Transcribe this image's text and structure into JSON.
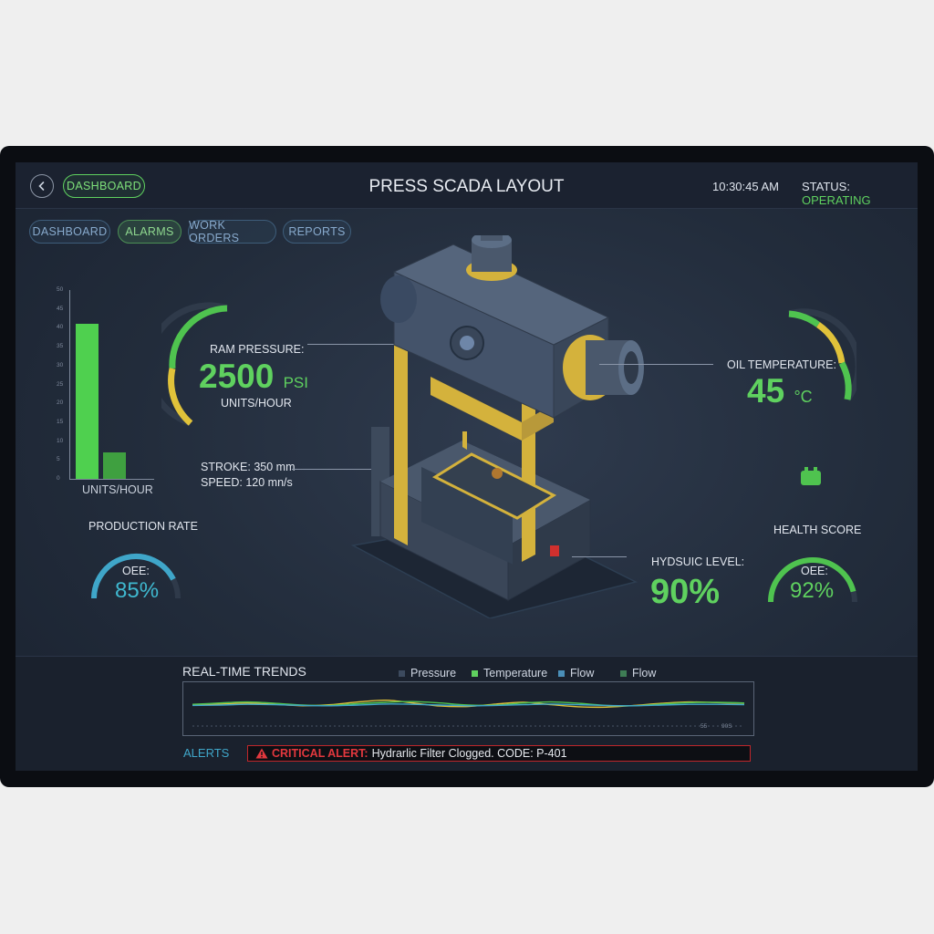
{
  "header": {
    "dashboard_pill": "DASHBOARD",
    "title": "PRESS SCADA LAYOUT",
    "time": "10:30:45 AM",
    "status_label": "STATUS:",
    "status_value": "OPERATING"
  },
  "nav": {
    "tabs": [
      {
        "label": "DASHBOARD"
      },
      {
        "label": "ALARMS"
      },
      {
        "label": "WORK ORDERS"
      },
      {
        "label": "REPORTS"
      }
    ]
  },
  "ram": {
    "label": "RAM PRESSURE:",
    "value": "2500",
    "unit": "PSI",
    "sub": "UNITS/HOUR"
  },
  "stroke": {
    "stroke_text": "STROKE: 350 mm",
    "speed_text": "SPEED: 120 mn/s"
  },
  "production": {
    "title": "PRODUCTION RATE",
    "oee_label": "OEE:",
    "oee_value": "85%",
    "oee_fraction": 0.85
  },
  "oil": {
    "label": "OIL TEMPERATURE:",
    "value": "45",
    "unit": "°C"
  },
  "hydraulic": {
    "label": "HYDSUIC LEVEL:",
    "value": "90%"
  },
  "health": {
    "title": "HEALTH SCORE",
    "oee_label": "OEE:",
    "oee_value": "92%",
    "oee_fraction": 0.92
  },
  "bar_chart": {
    "xlabel": "UNITS/HOUR",
    "ticks": [
      "0",
      "5",
      "10",
      "15",
      "20",
      "25",
      "30",
      "35",
      "40",
      "45",
      "50"
    ]
  },
  "trends": {
    "title": "REAL-TIME TRENDS",
    "legend": [
      {
        "name": "Pressure",
        "color": "#3c4a5e"
      },
      {
        "name": "Temperature",
        "color": "#5fd15f"
      },
      {
        "name": "Flow",
        "color": "#4a8fb8"
      },
      {
        "name": "Flow",
        "color": "#3e7d55"
      }
    ],
    "axis_labels": [
      "55",
      "90S"
    ]
  },
  "alerts": {
    "label": "ALERTS",
    "critical_label": "CRITICAL ALERT:",
    "message": "Hydrarlic Filter Clogged. CODE: P-401"
  },
  "colors": {
    "accent_green": "#5fd15f",
    "accent_blue": "#3fa6c9",
    "accent_yellow": "#e0c23a",
    "alert_red": "#e2383e"
  },
  "chart_data": [
    {
      "type": "bar",
      "categories": [
        "",
        ""
      ],
      "values": [
        41,
        7
      ],
      "xlabel": "UNITS/HOUR",
      "ylabel": "",
      "ylim": [
        0,
        50
      ]
    },
    {
      "type": "line",
      "title": "REAL-TIME TRENDS",
      "x": [
        0,
        1,
        2,
        3,
        4,
        5,
        6,
        7,
        8,
        9,
        10,
        11,
        12,
        13,
        14,
        15,
        16,
        17,
        18,
        19,
        20
      ],
      "series": [
        {
          "name": "Pressure",
          "values": [
            5.0,
            5.3,
            5.6,
            5.2,
            4.8,
            5.1,
            5.9,
            6.4,
            5.6,
            4.7,
            4.6,
            5.3,
            5.8,
            5.1,
            4.5,
            4.4,
            4.9,
            5.5,
            5.9,
            5.7,
            5.5
          ]
        },
        {
          "name": "Temperature",
          "values": [
            5.2,
            5.6,
            5.9,
            5.5,
            5.0,
            4.9,
            5.4,
            5.8,
            6.0,
            5.6,
            5.0,
            5.0,
            5.6,
            5.9,
            5.5,
            4.9,
            4.8,
            5.3,
            5.7,
            5.8,
            5.6
          ]
        },
        {
          "name": "Flow",
          "values": [
            4.9,
            5.0,
            5.2,
            5.1,
            4.9,
            4.8,
            5.0,
            5.3,
            5.2,
            5.0,
            4.8,
            4.9,
            5.1,
            5.3,
            5.1,
            4.9,
            4.8,
            5.0,
            5.2,
            5.2,
            5.1
          ]
        }
      ],
      "xlabel": "",
      "ylabel": "",
      "ylim": [
        0,
        10
      ]
    }
  ]
}
